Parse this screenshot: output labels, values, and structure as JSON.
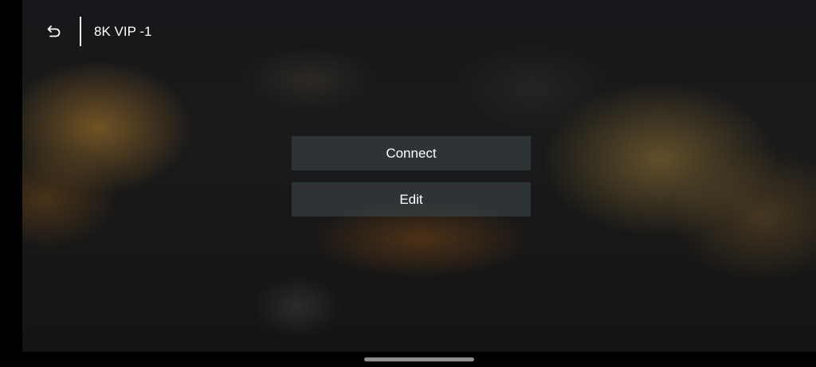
{
  "header": {
    "back_icon": "back-arrow-icon",
    "title": "8K VIP -1"
  },
  "actions": {
    "connect_label": "Connect",
    "edit_label": "Edit"
  },
  "colors": {
    "text": "#ffffff",
    "button_bg": "#3c4648",
    "background": "#000000"
  }
}
